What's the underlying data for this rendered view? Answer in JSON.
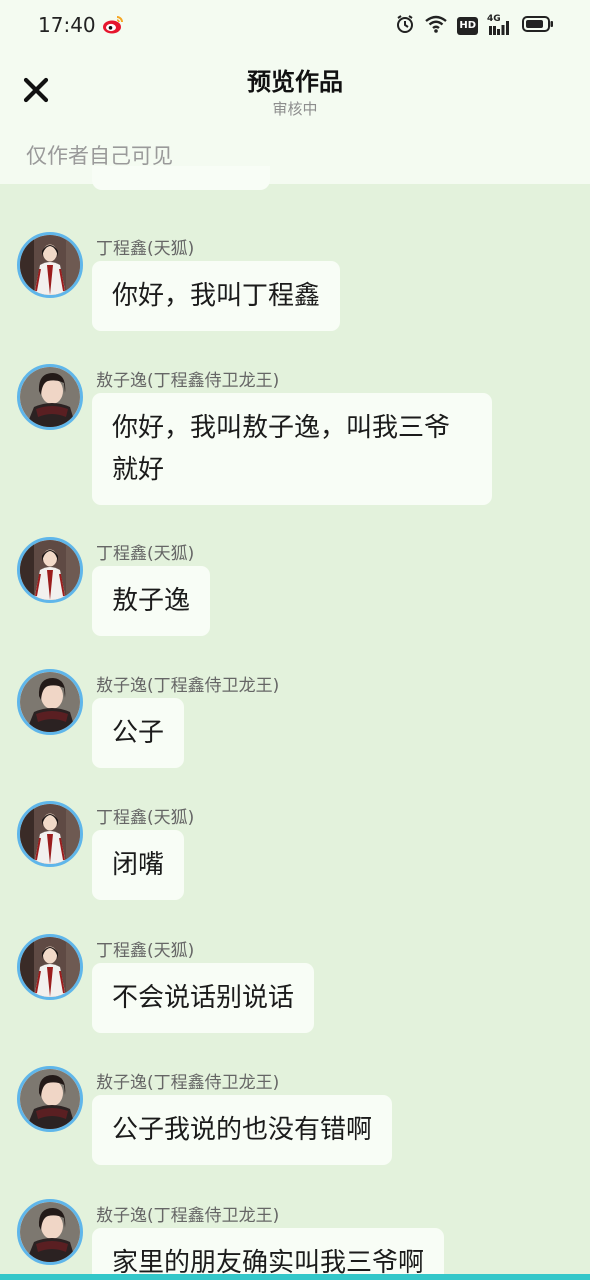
{
  "status_bar": {
    "time": "17:40",
    "icons": [
      "weibo-icon",
      "alarm-icon",
      "wifi-icon",
      "hd-icon",
      "signal-4g-icon",
      "battery-icon"
    ],
    "network_label": "4G",
    "hd_label": "HD"
  },
  "header": {
    "title": "预览作品",
    "subtitle": "审核中",
    "close_icon": "close-icon",
    "visibility_note": "仅作者自己可见"
  },
  "avatars": {
    "ding": {
      "bg": "#5f4a44",
      "robe": "#f2f0ee",
      "accent": "#9b1c1c"
    },
    "ao": {
      "bg": "#7d7870",
      "robe": "#5a1f22",
      "accent": "#2b2222"
    }
  },
  "messages": [
    {
      "speaker": "丁程鑫(天狐)",
      "avatar": "ding",
      "text": "你好，我叫丁程鑫"
    },
    {
      "speaker": "敖子逸(丁程鑫侍卫龙王)",
      "avatar": "ao",
      "text": "你好，我叫敖子逸，叫我三爷就好"
    },
    {
      "speaker": "丁程鑫(天狐)",
      "avatar": "ding",
      "text": "敖子逸"
    },
    {
      "speaker": "敖子逸(丁程鑫侍卫龙王)",
      "avatar": "ao",
      "text": "公子"
    },
    {
      "speaker": "丁程鑫(天狐)",
      "avatar": "ding",
      "text": "闭嘴"
    },
    {
      "speaker": "丁程鑫(天狐)",
      "avatar": "ding",
      "text": "不会说话别说话"
    },
    {
      "speaker": "敖子逸(丁程鑫侍卫龙王)",
      "avatar": "ao",
      "text": "公子我说的也没有错啊"
    },
    {
      "speaker": "敖子逸(丁程鑫侍卫龙王)",
      "avatar": "ao",
      "text": "家里的朋友确实叫我三爷啊"
    }
  ]
}
